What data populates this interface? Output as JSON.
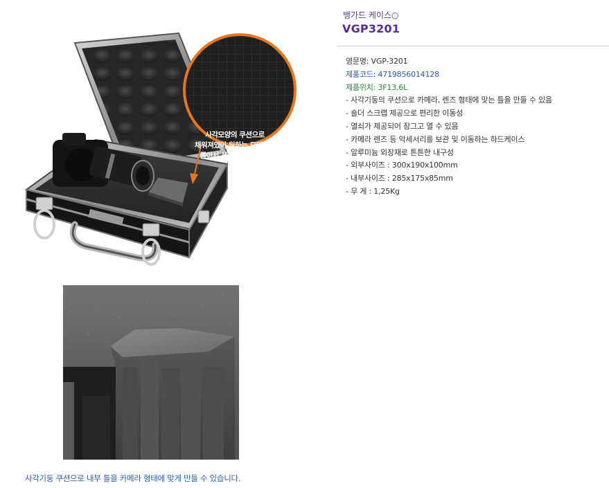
{
  "product": {
    "subtitle": "뱅가드 케이스○",
    "model": "VGP3201",
    "info": {
      "model_name": "영문명: VGP-3201",
      "product_code": "제품코드: 4719856014128",
      "location": "제품위치: 3F13,6L"
    },
    "features": [
      "- 사각기둥의 쿠션으로 카메라, 렌즈 형태에 맞는 틀을 만들 수 있음",
      "- 숄더 스크랩 제공으로 편리한 이동성",
      "- 열쇠가 제공되어 잠그고 열 수 있음",
      "- 카메라 렌즈 등 악세서리를 보관 및 이동하는 하드케이스",
      "- 알루미늄 외장재로 튼튼한 내구성",
      "- 외부사이즈 : 300x190x100mm",
      "- 내부사이즈 : 285x175x85mm",
      "- 무       게 : 1,25Kg"
    ]
  },
  "callout": {
    "lines": [
      "사각모양의 쿠션으로",
      "채워져있어 원하는 모양대로",
      "뽑아서 세팅할 수 있어요"
    ],
    "ring_color": "#e8761f"
  },
  "caption": "사각기둥 쿠션으로 내부 틀을 카메라 형태에 맞게 만들 수 있습니다.",
  "colors": {
    "purple_title": "#5b2a96",
    "blue_text": "#2a5cb5",
    "green_text": "#2e8b3a"
  }
}
